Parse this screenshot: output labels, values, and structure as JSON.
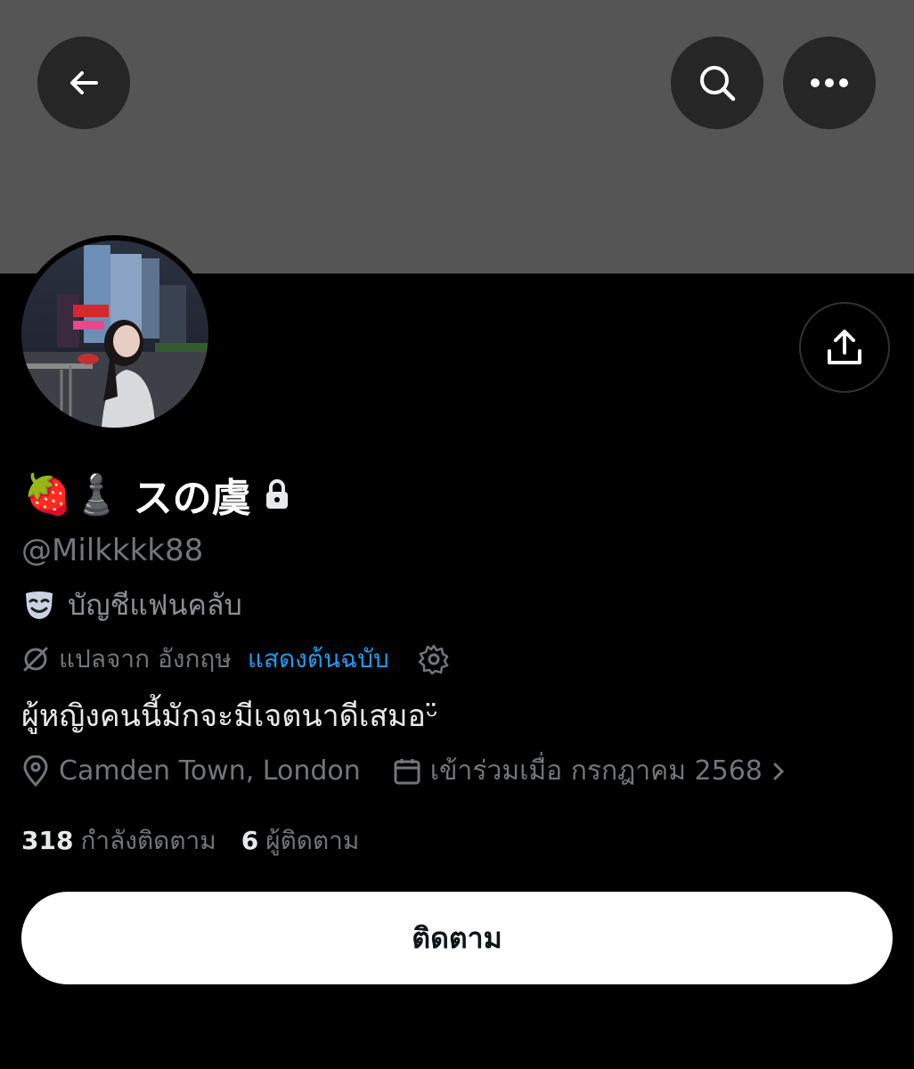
{
  "header": {
    "back_icon": "arrow-left-icon",
    "search_icon": "search-icon",
    "more_icon": "more-horizontal-icon"
  },
  "share_icon": "share-upload-icon",
  "profile": {
    "display_name_emoji": "🍓♟️",
    "display_name_text": "スの虞",
    "lock_icon": "lock-icon",
    "handle": "@Milkkkk88",
    "fan_account_label": "บัญชีแฟนคลับ",
    "translate_note": "แปลจาก อังกฤษ",
    "show_original_link": "แสดงต้นฉบับ",
    "bio": "ผู้หญิงคนนี้มักจะมีเจตนาดีเสมอ",
    "bio_symbol": "ᵕ̈",
    "location": "Camden Town, London",
    "joined": "เข้าร่วมเมื่อ กรกฎาคม 2568",
    "following_count": "318",
    "following_label": "กำลังติดตาม",
    "followers_count": "6",
    "followers_label": "ผู้ติดตาม"
  },
  "follow_button_label": "ติดตาม",
  "colors": {
    "link": "#1d9bf0",
    "muted": "#71767b",
    "banner": "#555555"
  }
}
